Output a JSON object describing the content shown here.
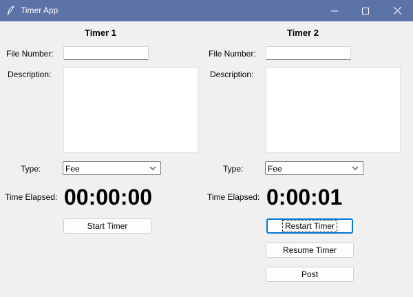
{
  "window": {
    "title": "Timer App"
  },
  "timer1": {
    "heading": "Timer 1",
    "file_number_label": "File Number:",
    "file_number_value": "",
    "description_label": "Description:",
    "description_value": "",
    "type_label": "Type:",
    "type_value": "Fee",
    "time_elapsed_label": "Time Elapsed:",
    "time_elapsed_value": "00:00:00",
    "start_button": "Start Timer"
  },
  "timer2": {
    "heading": "Timer 2",
    "file_number_label": "File Number:",
    "file_number_value": "",
    "description_label": "Description:",
    "description_value": "",
    "type_label": "Type:",
    "type_value": "Fee",
    "time_elapsed_label": "Time Elapsed:",
    "time_elapsed_value": "0:00:01",
    "restart_button": "Restart Timer",
    "resume_button": "Resume Timer",
    "post_button": "Post"
  },
  "icons": [
    "feather-icon",
    "minimize-icon",
    "maximize-icon",
    "close-icon",
    "chevron-down-icon"
  ]
}
